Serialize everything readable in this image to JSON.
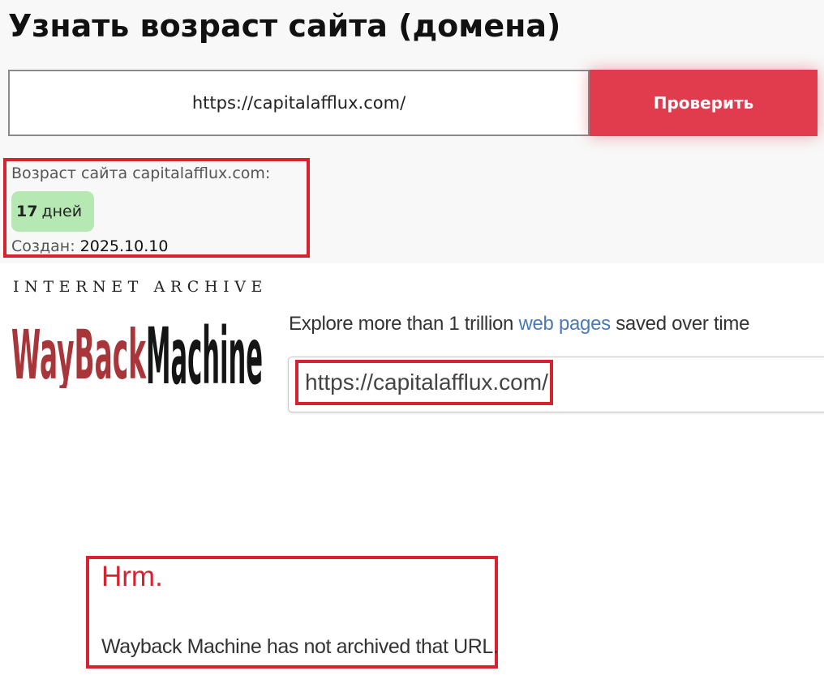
{
  "checker": {
    "title": "Узнать возраст сайта (домена)",
    "input_value": "https://capitalafflux.com/",
    "button_label": "Проверить",
    "result": {
      "age_label": "Возраст сайта capitalafflux.com:",
      "age_number": "17",
      "age_unit": "дней",
      "created_label": "Создан:",
      "created_value": "2025.10.10"
    }
  },
  "wayback": {
    "logo_top": "INTERNET ARCHIVE",
    "logo_part1": "WayBack",
    "logo_part2": "Machine",
    "logo_colors": {
      "wayback": "#a8353a",
      "machine": "#151515"
    },
    "explore_prefix": "Explore more than 1 trillion",
    "explore_link": "web pages",
    "explore_suffix": "saved over time",
    "search_value": "https://capitalafflux.com/",
    "error_title": "Hrm.",
    "error_message": "Wayback Machine has not archived that URL."
  },
  "colors": {
    "accent": "#e03c4e",
    "highlight_border": "#d6232f",
    "badge_bg": "#b5e8b3",
    "link": "#4a7ab5"
  }
}
